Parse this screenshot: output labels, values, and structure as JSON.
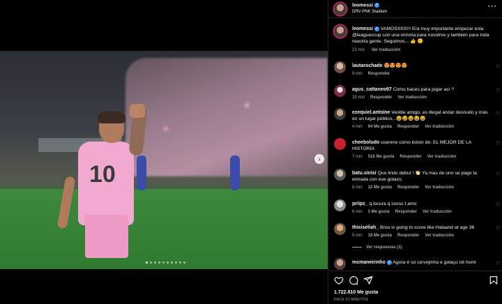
{
  "post": {
    "username": "leomessi",
    "location": "DRV PNK Stadium",
    "caption_user": "leomessi",
    "caption": "VAMOSSSS!!! Era muy importante empezar esta @leaguescup con una victoria para nosotros y también para toda nuestra gente. Seguimos... 👍 😊",
    "caption_time": "23 min",
    "see_translation": "Ver traducción",
    "likes": "1.722.810 Me gusta",
    "ago": "HACE 23 MINUTOS"
  },
  "comments": [
    {
      "user": "lautarochade",
      "text": "😍😍😍😍",
      "time": "9 min",
      "likes": "",
      "reply": "Responder",
      "translate": ""
    },
    {
      "user": "agus_cattaneo97",
      "text": "Cómo haces para jugar así ?",
      "time": "19 min",
      "likes": "",
      "reply": "Responder",
      "translate": "Ver traducción"
    },
    {
      "user": "ezequiel.antoine",
      "text": "Vestite amigo, es illegal andar desnudo y más en un lugar público...😆😆😆😆😆",
      "time": "4 min",
      "likes": "94 Me gusta",
      "reply": "Responder",
      "translate": "Ver traducción"
    },
    {
      "user": "cheeboludo",
      "text": "usenme como boton de: EL MEJOR DE LA HISTORIA",
      "time": "7 min",
      "likes": "516 Me gusta",
      "reply": "Responder",
      "translate": "Ver traducción"
    },
    {
      "user": "batu.sinisi",
      "text": "Que lindo debut ! 👏🏻 Ya mas de uno se pago la entrada con ese golazo.",
      "time": "8 min",
      "likes": "12 Me gusta",
      "reply": "Responder",
      "translate": "Ver traducción"
    },
    {
      "user": "priipz_",
      "text": "q locura q sosss t amo",
      "time": "6 min",
      "likes": "1 Me gusta",
      "reply": "Responder",
      "translate": "Ver traducción"
    },
    {
      "user": "thisiseliah_",
      "text": "Broo is going to score like Halaand at age 36",
      "time": "9 min",
      "likes": "18 Me gusta",
      "reply": "Responder",
      "translate": "Ver traducción"
    },
    {
      "user": "mcmaneirinho",
      "text": "Agora é só cervejinha e golaço né homi",
      "time": "",
      "likes": "",
      "reply": "",
      "translate": ""
    }
  ],
  "view_replies": "Ver respuestas (1)",
  "photo": {
    "jersey_number": "10",
    "nav_next": "›"
  },
  "icons": {
    "like": "heart-icon",
    "comment": "comment-icon",
    "share": "share-icon",
    "save": "bookmark-icon",
    "more": "more-icon",
    "verified": "verified-icon"
  },
  "colors": {
    "verified": "#3897f0",
    "jersey": "#f2a9cf",
    "muted_text": "#a8a8a8"
  }
}
